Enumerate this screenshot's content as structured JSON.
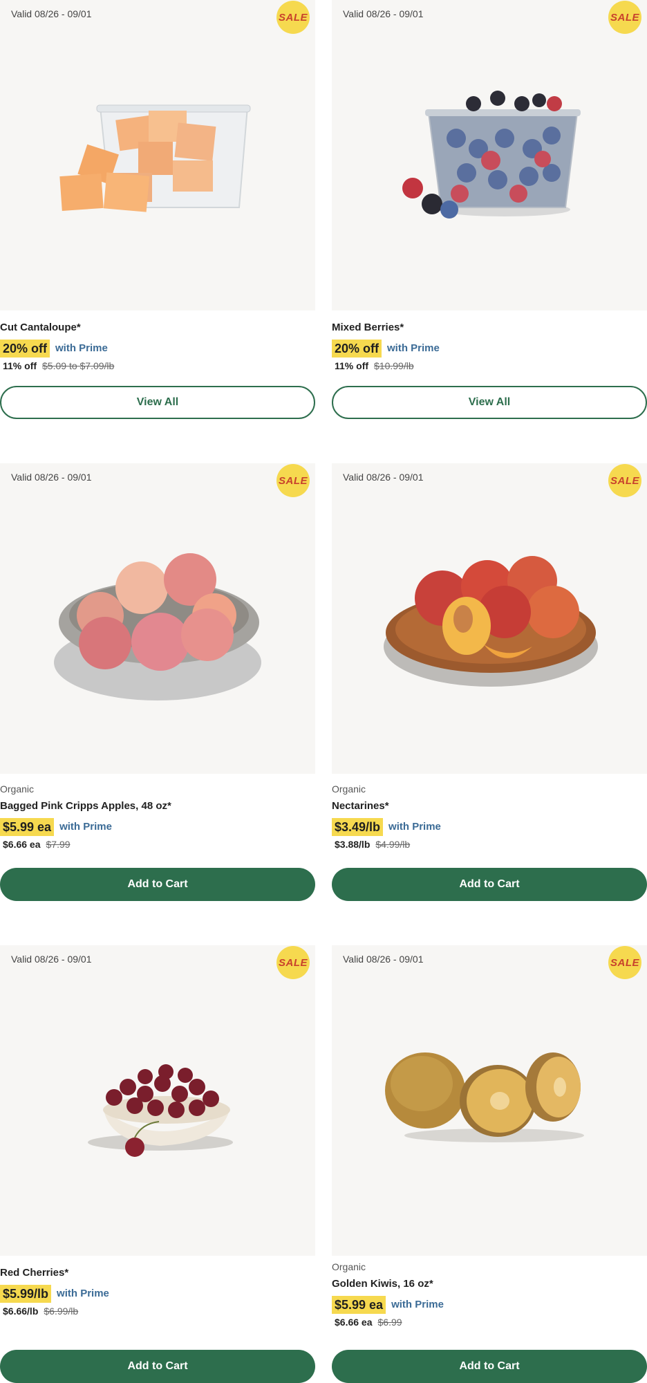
{
  "products": [
    {
      "valid": "Valid 08/26 - 09/01",
      "sale": "SALE",
      "organic": "",
      "name": "Cut Cantaloupe*",
      "deal": "20% off",
      "prime": "with Prime",
      "reg": "11% off",
      "strike": "$5.09 to $7.09/lb",
      "button": "View All",
      "image_icon": "cantaloupe-image"
    },
    {
      "valid": "Valid 08/26 - 09/01",
      "sale": "SALE",
      "organic": "",
      "name": "Mixed Berries*",
      "deal": "20% off",
      "prime": "with Prime",
      "reg": "11% off",
      "strike": "$10.99/lb",
      "button": "View All",
      "image_icon": "berries-image"
    },
    {
      "valid": "Valid 08/26 - 09/01",
      "sale": "SALE",
      "organic": "Organic",
      "name": "Bagged Pink Cripps Apples, 48 oz*",
      "deal": "$5.99 ea",
      "prime": "with Prime",
      "reg": "$6.66 ea",
      "strike": "$7.99",
      "button": "Add to Cart",
      "image_icon": "apples-image"
    },
    {
      "valid": "Valid 08/26 - 09/01",
      "sale": "SALE",
      "organic": "Organic",
      "name": "Nectarines*",
      "deal": "$3.49/lb",
      "prime": "with Prime",
      "reg": "$3.88/lb",
      "strike": "$4.99/lb",
      "button": "Add to Cart",
      "image_icon": "nectarines-image"
    },
    {
      "valid": "Valid 08/26 - 09/01",
      "sale": "SALE",
      "organic": "",
      "name": "Red Cherries*",
      "deal": "$5.99/lb",
      "prime": "with Prime",
      "reg": "$6.66/lb",
      "strike": "$6.99/lb",
      "button": "Add to Cart",
      "image_icon": "cherries-image"
    },
    {
      "valid": "Valid 08/26 - 09/01",
      "sale": "SALE",
      "organic": "Organic",
      "name": "Golden Kiwis, 16 oz*",
      "deal": "$5.99 ea",
      "prime": "with Prime",
      "reg": "$6.66 ea",
      "strike": "$6.99",
      "button": "Add to Cart",
      "image_icon": "kiwis-image"
    }
  ],
  "colors": {
    "accent_green": "#2d6e4d",
    "deal_yellow": "#f6d94f",
    "prime_blue": "#3b6b96",
    "sale_red": "#c8412c"
  }
}
